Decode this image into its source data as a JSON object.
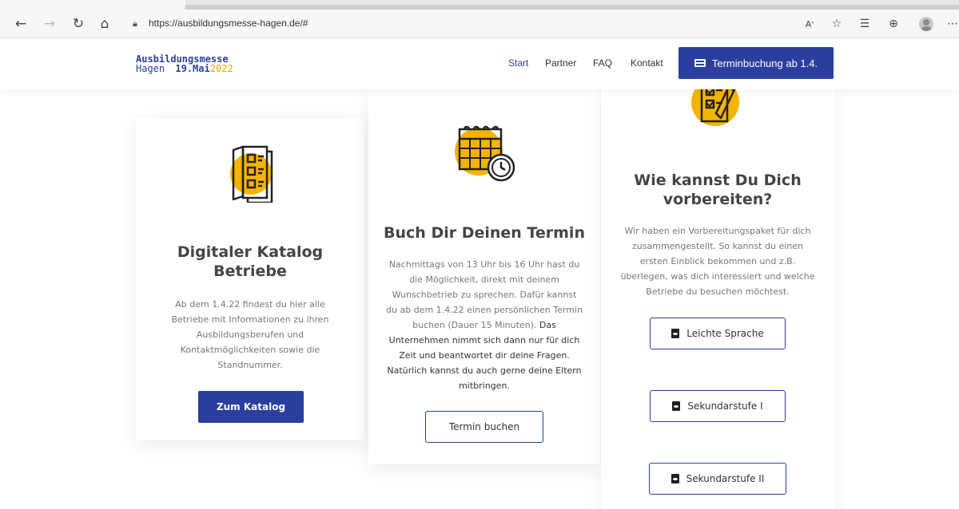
{
  "browser": {
    "url": "https://ausbildungsmesse-hagen.de/#",
    "icons": [
      "back-arrow",
      "forward-arrow",
      "reload",
      "home",
      "lock",
      "read-aloud",
      "favorites-star",
      "collections",
      "extensions",
      "profile-avatar",
      "more-menu"
    ]
  },
  "site": {
    "logo_line1": "Ausbildungsmesse",
    "logo_city": "Hagen",
    "logo_date": "19.Mai",
    "logo_year": "2022",
    "nav": [
      "Start",
      "Partner",
      "FAQ",
      "Kontakt"
    ],
    "cta_label": "Terminbuchung ab 1.4.",
    "colors": {
      "brand_blue": "#2a3f9d",
      "accent_yellow": "#f5b400"
    }
  },
  "cards": {
    "katalog": {
      "title": "Digitaler Katalog Betriebe",
      "text": "Ab dem 1.4.22 findest du hier alle Betriebe mit Informationen zu ihren Ausbildungsberufen und Kontaktmöglichkeiten sowie die Standnummer.",
      "button": "Zum Katalog",
      "icon": "catalog-icon"
    },
    "termin": {
      "title": "Buch Dir Deinen Termin",
      "text": "Nachmittags von 13 Uhr bis 16 Uhr hast du die Möglichkeit, direkt mit deinem Wunschbetrieb zu sprechen. Dafür kannst du ab dem 1.4.22 einen persönlichen Termin buchen (Dauer 15 Minuten).",
      "text_strong": "Das Unternehmen nimmt sich dann nur für dich Zeit und beantwortet dir deine Fragen. Natürlich kannst du auch gerne deine Eltern mitbringen.",
      "button": "Termin buchen",
      "icon": "calendar-clock-icon"
    },
    "vorbereitung": {
      "title": "Wie kannst Du Dich vorbereiten?",
      "text": "Wir haben ein Vorbereitungspaket für dich zusammengestellt. So kannst du einen ersten Einblick bekommen und z.B. überlegen, was dich interessiert und welche Betriebe du besuchen möchtest.",
      "buttons": [
        "Leichte Sprache",
        "Sekundarstufe I",
        "Sekundarstufe II"
      ],
      "icon": "checklist-icon"
    }
  }
}
